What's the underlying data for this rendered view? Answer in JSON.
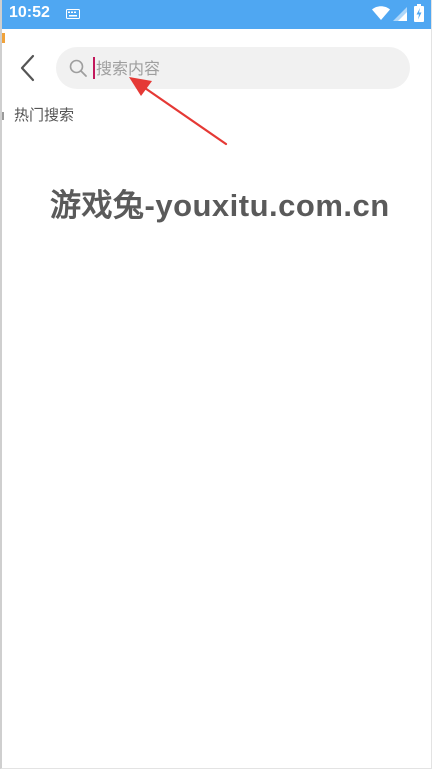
{
  "status_bar": {
    "time": "10:52",
    "background_color": "#4fa7f2",
    "icons": [
      "keyboard-icon",
      "wifi-icon",
      "cellular-signal-icon",
      "battery-charging-icon"
    ]
  },
  "header": {
    "back_icon": "chevron-left-icon",
    "search": {
      "placeholder": "搜索内容",
      "value": "",
      "icon": "search-icon"
    }
  },
  "hot_search": {
    "title": "热门搜索",
    "items": []
  },
  "annotation": {
    "type": "red-arrow",
    "color": "#e53935"
  },
  "watermark": {
    "text": "游戏兔-youxitu.com.cn"
  }
}
